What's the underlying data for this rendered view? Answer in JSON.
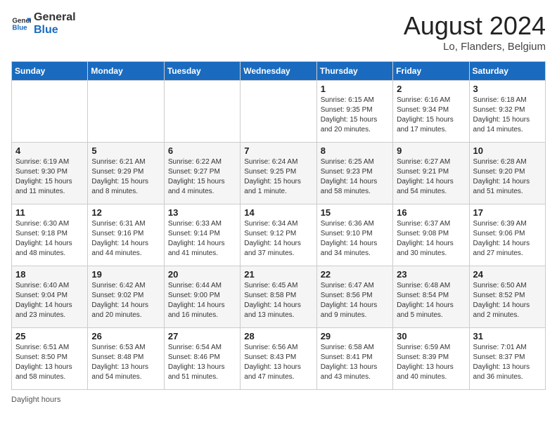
{
  "header": {
    "logo_general": "General",
    "logo_blue": "Blue",
    "month_year": "August 2024",
    "location": "Lo, Flanders, Belgium"
  },
  "weekdays": [
    "Sunday",
    "Monday",
    "Tuesday",
    "Wednesday",
    "Thursday",
    "Friday",
    "Saturday"
  ],
  "footer": {
    "daylight_label": "Daylight hours"
  },
  "weeks": [
    [
      {
        "day": "",
        "detail": ""
      },
      {
        "day": "",
        "detail": ""
      },
      {
        "day": "",
        "detail": ""
      },
      {
        "day": "",
        "detail": ""
      },
      {
        "day": "1",
        "detail": "Sunrise: 6:15 AM\nSunset: 9:35 PM\nDaylight: 15 hours\nand 20 minutes."
      },
      {
        "day": "2",
        "detail": "Sunrise: 6:16 AM\nSunset: 9:34 PM\nDaylight: 15 hours\nand 17 minutes."
      },
      {
        "day": "3",
        "detail": "Sunrise: 6:18 AM\nSunset: 9:32 PM\nDaylight: 15 hours\nand 14 minutes."
      }
    ],
    [
      {
        "day": "4",
        "detail": "Sunrise: 6:19 AM\nSunset: 9:30 PM\nDaylight: 15 hours\nand 11 minutes."
      },
      {
        "day": "5",
        "detail": "Sunrise: 6:21 AM\nSunset: 9:29 PM\nDaylight: 15 hours\nand 8 minutes."
      },
      {
        "day": "6",
        "detail": "Sunrise: 6:22 AM\nSunset: 9:27 PM\nDaylight: 15 hours\nand 4 minutes."
      },
      {
        "day": "7",
        "detail": "Sunrise: 6:24 AM\nSunset: 9:25 PM\nDaylight: 15 hours\nand 1 minute."
      },
      {
        "day": "8",
        "detail": "Sunrise: 6:25 AM\nSunset: 9:23 PM\nDaylight: 14 hours\nand 58 minutes."
      },
      {
        "day": "9",
        "detail": "Sunrise: 6:27 AM\nSunset: 9:21 PM\nDaylight: 14 hours\nand 54 minutes."
      },
      {
        "day": "10",
        "detail": "Sunrise: 6:28 AM\nSunset: 9:20 PM\nDaylight: 14 hours\nand 51 minutes."
      }
    ],
    [
      {
        "day": "11",
        "detail": "Sunrise: 6:30 AM\nSunset: 9:18 PM\nDaylight: 14 hours\nand 48 minutes."
      },
      {
        "day": "12",
        "detail": "Sunrise: 6:31 AM\nSunset: 9:16 PM\nDaylight: 14 hours\nand 44 minutes."
      },
      {
        "day": "13",
        "detail": "Sunrise: 6:33 AM\nSunset: 9:14 PM\nDaylight: 14 hours\nand 41 minutes."
      },
      {
        "day": "14",
        "detail": "Sunrise: 6:34 AM\nSunset: 9:12 PM\nDaylight: 14 hours\nand 37 minutes."
      },
      {
        "day": "15",
        "detail": "Sunrise: 6:36 AM\nSunset: 9:10 PM\nDaylight: 14 hours\nand 34 minutes."
      },
      {
        "day": "16",
        "detail": "Sunrise: 6:37 AM\nSunset: 9:08 PM\nDaylight: 14 hours\nand 30 minutes."
      },
      {
        "day": "17",
        "detail": "Sunrise: 6:39 AM\nSunset: 9:06 PM\nDaylight: 14 hours\nand 27 minutes."
      }
    ],
    [
      {
        "day": "18",
        "detail": "Sunrise: 6:40 AM\nSunset: 9:04 PM\nDaylight: 14 hours\nand 23 minutes."
      },
      {
        "day": "19",
        "detail": "Sunrise: 6:42 AM\nSunset: 9:02 PM\nDaylight: 14 hours\nand 20 minutes."
      },
      {
        "day": "20",
        "detail": "Sunrise: 6:44 AM\nSunset: 9:00 PM\nDaylight: 14 hours\nand 16 minutes."
      },
      {
        "day": "21",
        "detail": "Sunrise: 6:45 AM\nSunset: 8:58 PM\nDaylight: 14 hours\nand 13 minutes."
      },
      {
        "day": "22",
        "detail": "Sunrise: 6:47 AM\nSunset: 8:56 PM\nDaylight: 14 hours\nand 9 minutes."
      },
      {
        "day": "23",
        "detail": "Sunrise: 6:48 AM\nSunset: 8:54 PM\nDaylight: 14 hours\nand 5 minutes."
      },
      {
        "day": "24",
        "detail": "Sunrise: 6:50 AM\nSunset: 8:52 PM\nDaylight: 14 hours\nand 2 minutes."
      }
    ],
    [
      {
        "day": "25",
        "detail": "Sunrise: 6:51 AM\nSunset: 8:50 PM\nDaylight: 13 hours\nand 58 minutes."
      },
      {
        "day": "26",
        "detail": "Sunrise: 6:53 AM\nSunset: 8:48 PM\nDaylight: 13 hours\nand 54 minutes."
      },
      {
        "day": "27",
        "detail": "Sunrise: 6:54 AM\nSunset: 8:46 PM\nDaylight: 13 hours\nand 51 minutes."
      },
      {
        "day": "28",
        "detail": "Sunrise: 6:56 AM\nSunset: 8:43 PM\nDaylight: 13 hours\nand 47 minutes."
      },
      {
        "day": "29",
        "detail": "Sunrise: 6:58 AM\nSunset: 8:41 PM\nDaylight: 13 hours\nand 43 minutes."
      },
      {
        "day": "30",
        "detail": "Sunrise: 6:59 AM\nSunset: 8:39 PM\nDaylight: 13 hours\nand 40 minutes."
      },
      {
        "day": "31",
        "detail": "Sunrise: 7:01 AM\nSunset: 8:37 PM\nDaylight: 13 hours\nand 36 minutes."
      }
    ]
  ]
}
